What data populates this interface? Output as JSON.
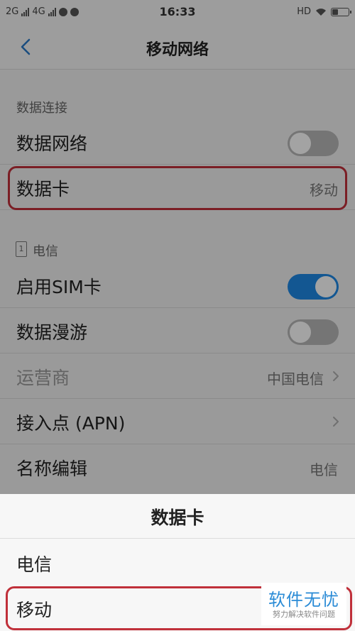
{
  "status_bar": {
    "sim1": "2G",
    "sim2": "4G",
    "time": "16:33",
    "hd": "HD"
  },
  "header": {
    "title": "移动网络",
    "back_icon": "chevron-left-icon"
  },
  "data_connection": {
    "section_label": "数据连接",
    "data_network": {
      "label": "数据网络",
      "enabled": false
    },
    "data_card": {
      "label": "数据卡",
      "value": "移动"
    }
  },
  "sim_telecom": {
    "sim_number": "1",
    "section_label": "电信",
    "enable_sim": {
      "label": "启用SIM卡",
      "enabled": true
    },
    "data_roaming": {
      "label": "数据漫游",
      "enabled": false
    },
    "carrier": {
      "label": "运营商",
      "value": "中国电信"
    },
    "apn": {
      "label": "接入点 (APN)"
    },
    "name_edit": {
      "label": "名称编辑",
      "value": "电信"
    }
  },
  "sheet": {
    "title": "数据卡",
    "options": [
      {
        "label": "电信"
      },
      {
        "label": "移动"
      }
    ]
  },
  "watermark": {
    "main": "软件无忧",
    "sub": "努力解决软件问题"
  },
  "colors": {
    "accent": "#1e88e5",
    "highlight": "#c0303a",
    "back_arrow": "#2979c7"
  }
}
